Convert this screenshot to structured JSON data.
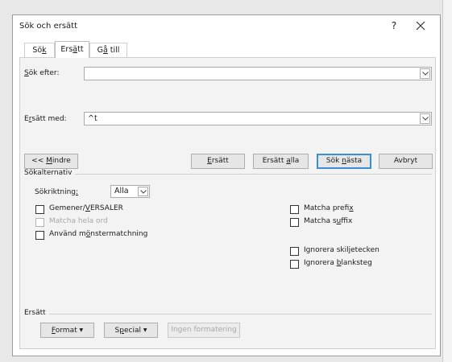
{
  "dialog": {
    "title": "Sök och ersätt",
    "help": "?"
  },
  "tabs": {
    "search": {
      "pre": "Sö",
      "mn": "k",
      "post": ""
    },
    "replace": {
      "pre": "Ers",
      "mn": "ä",
      "post": "tt"
    },
    "goto": {
      "pre": "G",
      "mn": "å",
      "post": " till"
    }
  },
  "find": {
    "label_mn": "S",
    "label_rest": "ök efter:",
    "value": ""
  },
  "replace": {
    "label_pre": "E",
    "label_mn": "r",
    "label_post": "sätt med:",
    "value": "^t"
  },
  "buttons": {
    "less_pre": "<< ",
    "less_mn": "M",
    "less_post": "indre",
    "replace_mn": "E",
    "replace_post": "rsätt",
    "replace_all_pre": "Ersätt ",
    "replace_all_mn": "a",
    "replace_all_post": "lla",
    "find_next_pre": "Sök ",
    "find_next_mn": "n",
    "find_next_post": "ästa",
    "cancel": "Avbryt"
  },
  "options": {
    "group_title": "Sökalternativ",
    "direction_label_pre": "Sökriktning",
    "direction_label_mn": ":",
    "direction_value": "Alla",
    "match_case_pre": "Gemener/",
    "match_case_mn": "V",
    "match_case_post": "ERSALER",
    "whole_words": "Matcha hela ord",
    "wildcards_pre": "Använd m",
    "wildcards_mn": "ö",
    "wildcards_post": "nstermatchning",
    "prefix_pre": "Matcha prefi",
    "prefix_mn": "x",
    "prefix_post": "",
    "suffix_pre": "Matcha s",
    "suffix_mn": "u",
    "suffix_post": "ffix",
    "ignore_punct_pre": "Ignorera skil",
    "ignore_punct_mn": "j",
    "ignore_punct_post": "etecken",
    "ignore_space_pre": "Ignorera ",
    "ignore_space_mn": "b",
    "ignore_space_post": "lanksteg"
  },
  "replace_group": {
    "title": "Ersätt",
    "format_mn": "F",
    "format_post": "ormat",
    "special_pre": "S",
    "special_mn": "p",
    "special_post": "ecial",
    "no_formatting": "Ingen formatering"
  }
}
